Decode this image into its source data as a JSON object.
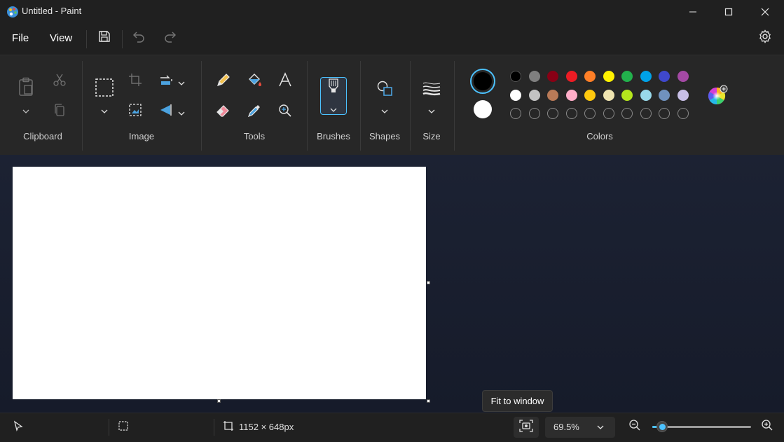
{
  "window": {
    "title": "Untitled - Paint",
    "app_icon": "paint-palette-icon",
    "controls": [
      "minimize-icon",
      "maximize-icon",
      "close-icon"
    ]
  },
  "menu": {
    "file_label": "File",
    "view_label": "View",
    "icons": [
      "save-icon",
      "undo-icon",
      "redo-icon",
      "gear-icon"
    ]
  },
  "ribbon": {
    "groups": {
      "clipboard": "Clipboard",
      "image": "Image",
      "tools": "Tools",
      "brushes": "Brushes",
      "shapes": "Shapes",
      "size": "Size",
      "colors": "Colors"
    },
    "tool_icons": [
      "pencil-icon",
      "fill-bucket-icon",
      "text-icon",
      "eraser-icon",
      "color-picker-icon",
      "magnifier-icon"
    ],
    "primary_color": "#000000",
    "secondary_color": "#ffffff",
    "palette_row1": [
      "#000000",
      "#7f7f7f",
      "#880015",
      "#ed1c24",
      "#ff7f27",
      "#fff200",
      "#22b14c",
      "#00a2e8",
      "#3f48cc",
      "#a349a4"
    ],
    "palette_row2": [
      "#ffffff",
      "#c3c3c3",
      "#b97a57",
      "#ffaec9",
      "#ffc90e",
      "#efe4b0",
      "#b5e61d",
      "#99d9ea",
      "#7092be",
      "#c8bfe7"
    ]
  },
  "status": {
    "canvas_size": "1152 × 648px",
    "zoom_value": "69.5%",
    "zoom_fraction": 0.1,
    "tooltip": "Fit to window"
  }
}
